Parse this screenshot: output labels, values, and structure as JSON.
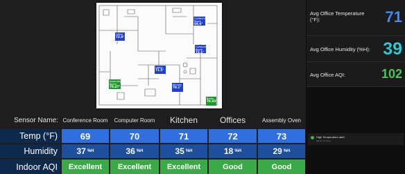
{
  "floorplan": {
    "labels": [
      {
        "id": "conference",
        "name": "Conference Room",
        "value": "69.0°",
        "color": "blue"
      },
      {
        "id": "office",
        "name": "Office",
        "value": "72.0°",
        "color": "blue"
      },
      {
        "id": "computer",
        "name": "Computer Room",
        "value": "72.1°",
        "color": "blue"
      },
      {
        "id": "lobby",
        "name": "Lobby",
        "value": "71.5°",
        "color": "blue"
      },
      {
        "id": "kitchen",
        "name": "Kitchen",
        "value": "70.1°",
        "color": "blue"
      },
      {
        "id": "assembly",
        "name": "Assembly Room",
        "value": "70.47°",
        "color": "green"
      },
      {
        "id": "break",
        "name": "Break",
        "value": "70.45°",
        "color": "green"
      }
    ]
  },
  "table": {
    "header_label": "Sensor Name:",
    "columns": [
      "Conference Room",
      "Computer Room",
      "Kitchen",
      "Offices",
      "Assembly Oven"
    ],
    "rows": [
      {
        "label": "Temp (°F)",
        "values": [
          "69",
          "70",
          "71",
          "72",
          "73"
        ],
        "unit": ""
      },
      {
        "label": "Humidity",
        "values": [
          "37",
          "36",
          "35",
          "18",
          "29"
        ],
        "unit": "%H"
      },
      {
        "label": "Indoor AQI",
        "values": [
          "Excellent",
          "Excellent",
          "Excellent",
          "Good",
          "Good"
        ],
        "unit": ""
      }
    ]
  },
  "stats": [
    {
      "label": "Avg Office Temperature (°F):",
      "value": "71",
      "color": "#3d8df5"
    },
    {
      "label": "Avg Office Humidity (%H):",
      "value": "39",
      "color": "#2fc7d1"
    },
    {
      "label": "Avg Office AQI:",
      "value": "102",
      "color": "#4fc25f"
    }
  ],
  "alert": {
    "title": "High Temperature alert",
    "subtitle": "3M for 11 hours",
    "color": "#4caf50"
  }
}
